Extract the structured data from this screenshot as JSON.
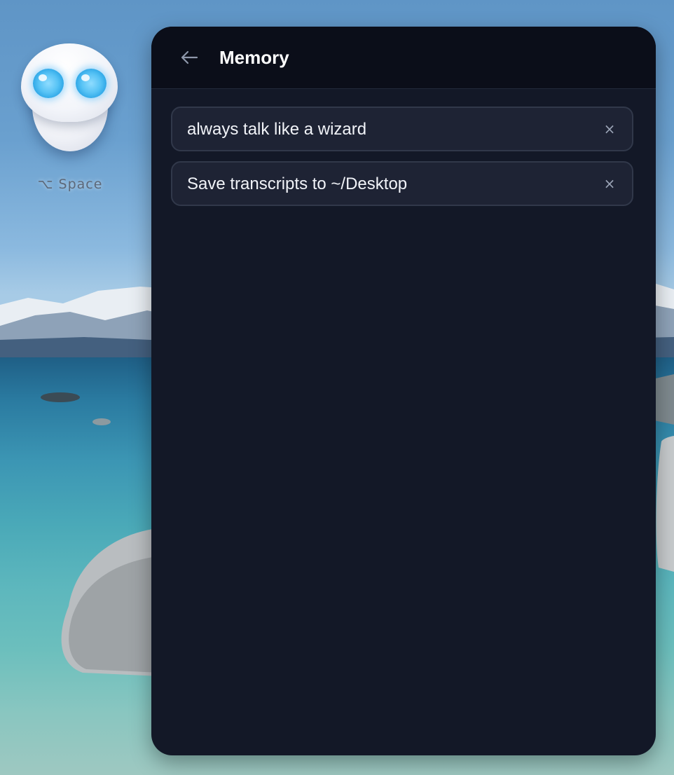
{
  "desktop": {
    "shortcut_label": "⌥ Space",
    "mascot_icon": "robot-mascot-icon"
  },
  "panel": {
    "title": "Memory",
    "back_icon": "arrow-left-icon",
    "memories": [
      {
        "text": "always talk like a wizard",
        "delete_icon": "close-icon",
        "delete_label": "×"
      },
      {
        "text": "Save transcripts to ~/Desktop",
        "delete_icon": "close-icon",
        "delete_label": "×"
      }
    ]
  },
  "colors": {
    "panel_bg": "#131827",
    "header_bg": "#0b0e19",
    "item_bg": "#1e2334",
    "item_border": "#31384a",
    "text": "#f1f3f8",
    "muted": "#9aa3b5"
  }
}
